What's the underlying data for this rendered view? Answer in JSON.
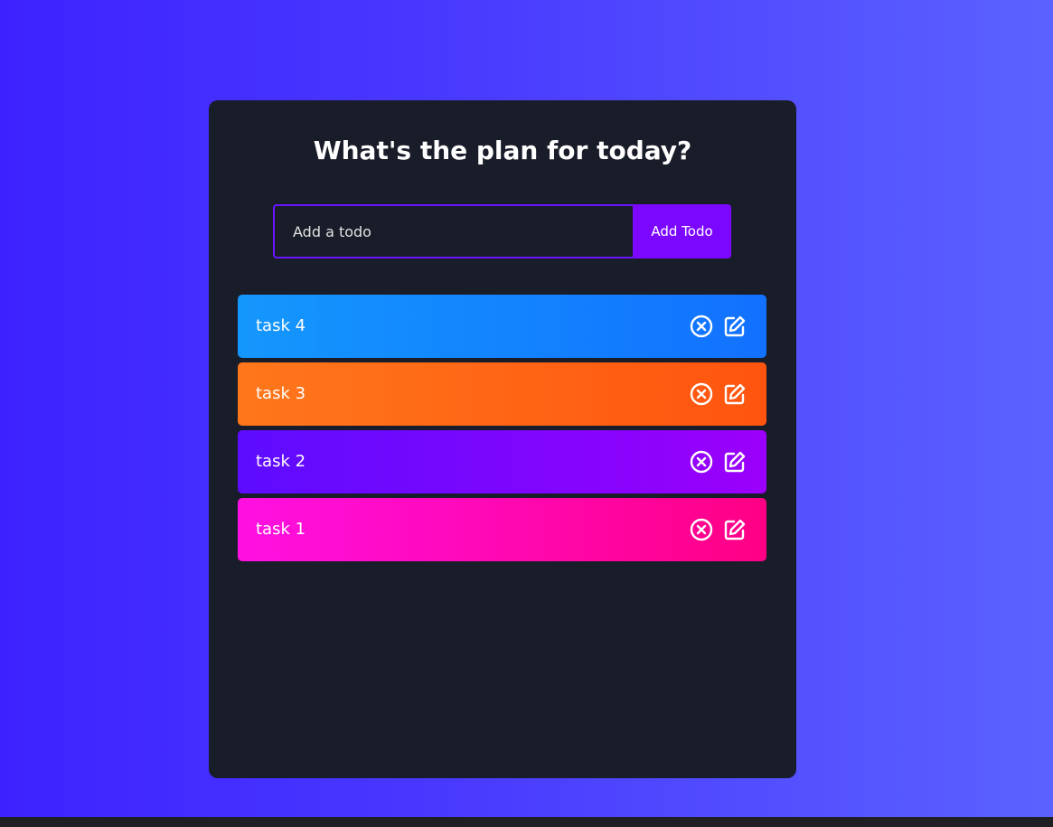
{
  "app": {
    "title": "What's the plan for today?"
  },
  "form": {
    "placeholder": "Add a todo",
    "value": "",
    "button_label": "Add Todo"
  },
  "todos": [
    {
      "text": "task 4",
      "color": "blue"
    },
    {
      "text": "task 3",
      "color": "orange"
    },
    {
      "text": "task 2",
      "color": "purple"
    },
    {
      "text": "task 1",
      "color": "pink"
    }
  ],
  "icons": {
    "delete": "close-circle-icon",
    "edit": "edit-icon"
  },
  "colors": {
    "background_start": "#3d22ff",
    "background_end": "#5b62ff",
    "panel": "#191c29",
    "accent": "#7c07ff",
    "blue_start": "#1497fd",
    "orange_start": "#ff771b",
    "purple_start": "#5d0cff",
    "pink_start": "#ff10e2"
  }
}
